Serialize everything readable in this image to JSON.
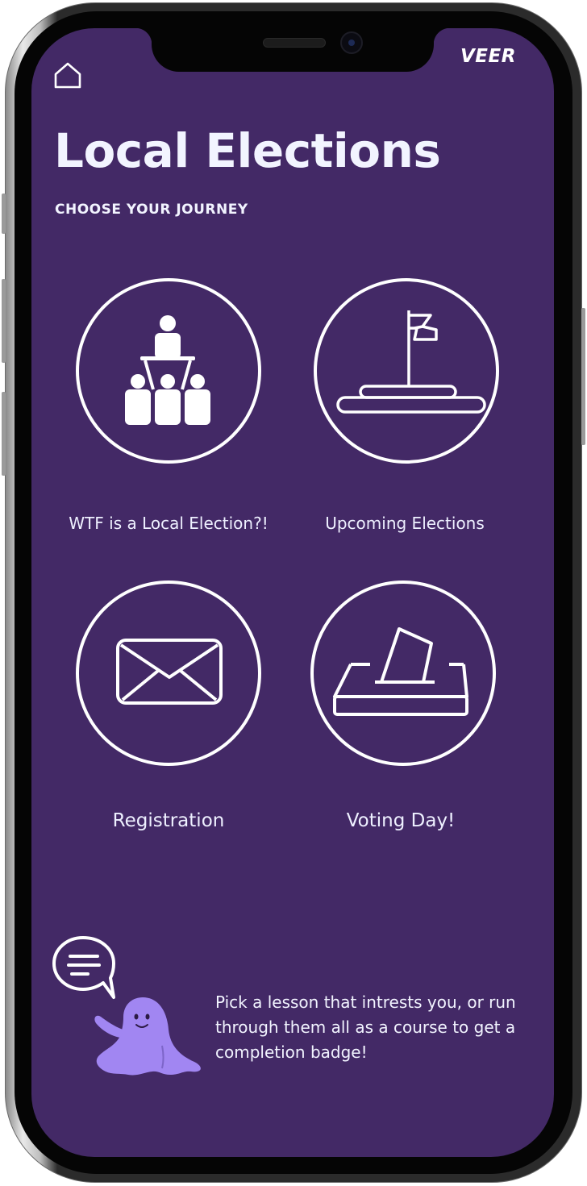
{
  "app": {
    "brand": "VEER",
    "title": "Local Elections",
    "subtitle": "CHOOSE YOUR JOURNEY"
  },
  "journeys": [
    {
      "label": "WTF is a Local Election?!",
      "icon": "people-podium-icon"
    },
    {
      "label": "Upcoming Elections",
      "icon": "flag-podium-icon"
    },
    {
      "label": "Registration",
      "icon": "envelope-icon"
    },
    {
      "label": "Voting Day!",
      "icon": "ballot-box-icon"
    }
  ],
  "helper": {
    "text": "Pick a lesson that intrests you, or run through them all as a course to get a completion badge!"
  },
  "colors": {
    "background": "#432966",
    "icon_stroke": "#ffffff",
    "mascot": "#a186f2"
  }
}
